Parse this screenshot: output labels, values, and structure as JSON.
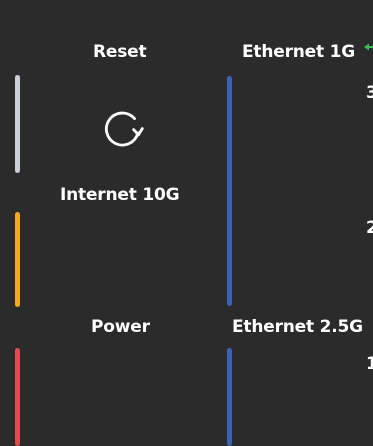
{
  "labels": {
    "reset": "Reset",
    "internet_10g": "Internet 10G",
    "power": "Power",
    "ethernet_1g": "Ethernet 1G",
    "ethernet_2_5g": "Ethernet 2.5G"
  },
  "port_numbers": [
    "3",
    "2",
    "1"
  ],
  "status_colors": {
    "reset": "#c9d0db",
    "internet": "#f5a623",
    "power": "#e5484d",
    "ethernet": "#3d63b0",
    "link_indicator": "#3fb950"
  },
  "icons": {
    "reset": "rotate-clockwise-icon"
  }
}
